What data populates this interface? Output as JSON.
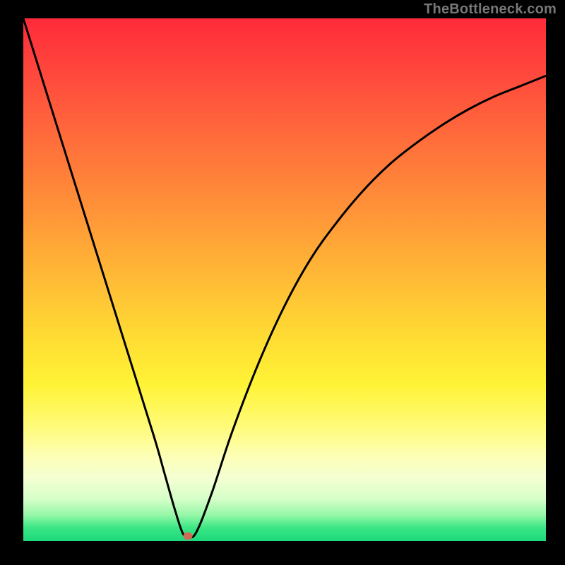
{
  "watermark": "TheBottleneck.com",
  "colors": {
    "background": "#000000",
    "curve": "#000000",
    "marker": "#cf6a57"
  },
  "chart_data": {
    "type": "line",
    "title": "",
    "xlabel": "",
    "ylabel": "",
    "xlim": [
      0,
      100
    ],
    "ylim": [
      0,
      100
    ],
    "grid": false,
    "annotations": [
      "TheBottleneck.com"
    ],
    "series": [
      {
        "name": "bottleneck-curve",
        "x": [
          0,
          5,
          10,
          15,
          20,
          25,
          27,
          29,
          30.5,
          31.5,
          33,
          36,
          40,
          45,
          50,
          55,
          60,
          65,
          70,
          75,
          80,
          85,
          90,
          95,
          100
        ],
        "values": [
          100,
          84,
          68,
          52,
          36,
          20,
          13,
          6,
          1.5,
          1,
          1.5,
          9,
          21,
          34,
          45,
          54,
          61,
          67,
          72,
          76,
          79.5,
          82.5,
          85,
          87,
          89
        ]
      }
    ],
    "marker": {
      "x": 31.5,
      "y": 1
    }
  }
}
